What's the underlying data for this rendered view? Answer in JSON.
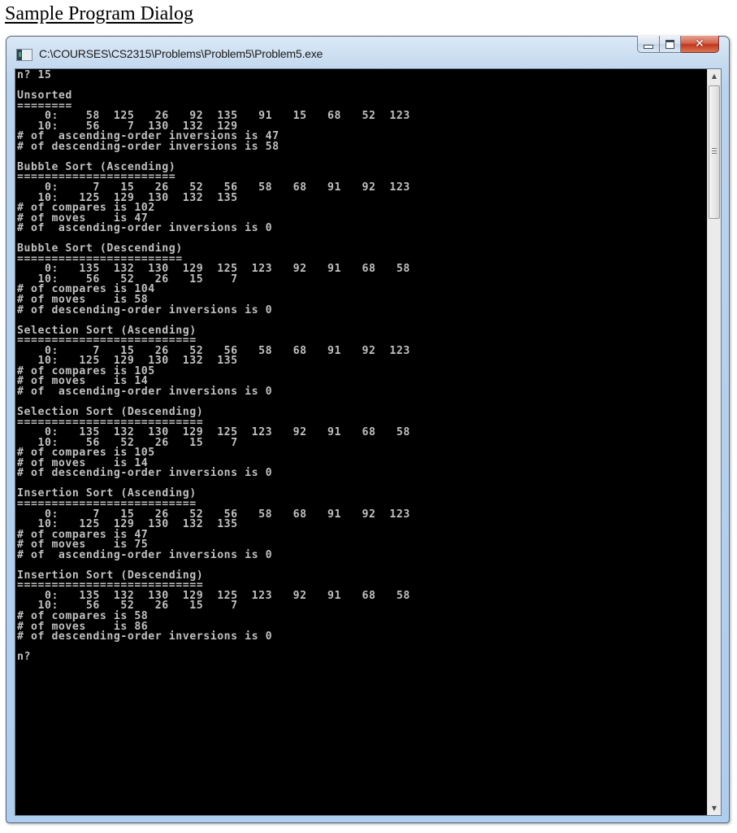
{
  "page": {
    "heading": "Sample Program Dialog"
  },
  "window": {
    "title": "C:\\COURSES\\CS2315\\Problems\\Problem5\\Problem5.exe",
    "icon": "console-app-icon",
    "buttons": {
      "minimize": "minimize-icon",
      "maximize": "maximize-icon",
      "close": "close-icon"
    }
  },
  "console": {
    "lines": [
      "n? 15",
      "",
      "Unsorted",
      "========",
      "    0:    58  125   26   92  135   91   15   68   52  123",
      "   10:    56    7  130  132  129",
      "# of  ascending-order inversions is 47",
      "# of descending-order inversions is 58",
      "",
      "Bubble Sort (Ascending)",
      "=======================",
      "    0:     7   15   26   52   56   58   68   91   92  123",
      "   10:   125  129  130  132  135",
      "# of compares is 102",
      "# of moves    is 47",
      "# of  ascending-order inversions is 0",
      "",
      "Bubble Sort (Descending)",
      "========================",
      "    0:   135  132  130  129  125  123   92   91   68   58",
      "   10:    56   52   26   15    7",
      "# of compares is 104",
      "# of moves    is 58",
      "# of descending-order inversions is 0",
      "",
      "Selection Sort (Ascending)",
      "==========================",
      "    0:     7   15   26   52   56   58   68   91   92  123",
      "   10:   125  129  130  132  135",
      "# of compares is 105",
      "# of moves    is 14",
      "# of  ascending-order inversions is 0",
      "",
      "Selection Sort (Descending)",
      "===========================",
      "    0:   135  132  130  129  125  123   92   91   68   58",
      "   10:    56   52   26   15    7",
      "# of compares is 105",
      "# of moves    is 14",
      "# of descending-order inversions is 0",
      "",
      "Insertion Sort (Ascending)",
      "==========================",
      "    0:     7   15   26   52   56   58   68   91   92  123",
      "   10:   125  129  130  132  135",
      "# of compares is 47",
      "# of moves    is 75",
      "# of  ascending-order inversions is 0",
      "",
      "Insertion Sort (Descending)",
      "===========================",
      "    0:   135  132  130  129  125  123   92   91   68   58",
      "   10:    56   52   26   15    7",
      "# of compares is 58",
      "# of moves    is 86",
      "# of descending-order inversions is 0",
      "",
      "n?"
    ],
    "colors": {
      "background": "#000000",
      "foreground": "#c0c0c0"
    }
  },
  "scrollbar": {
    "up_arrow": "▲",
    "down_arrow": "▼",
    "position_fraction": 0.0
  }
}
